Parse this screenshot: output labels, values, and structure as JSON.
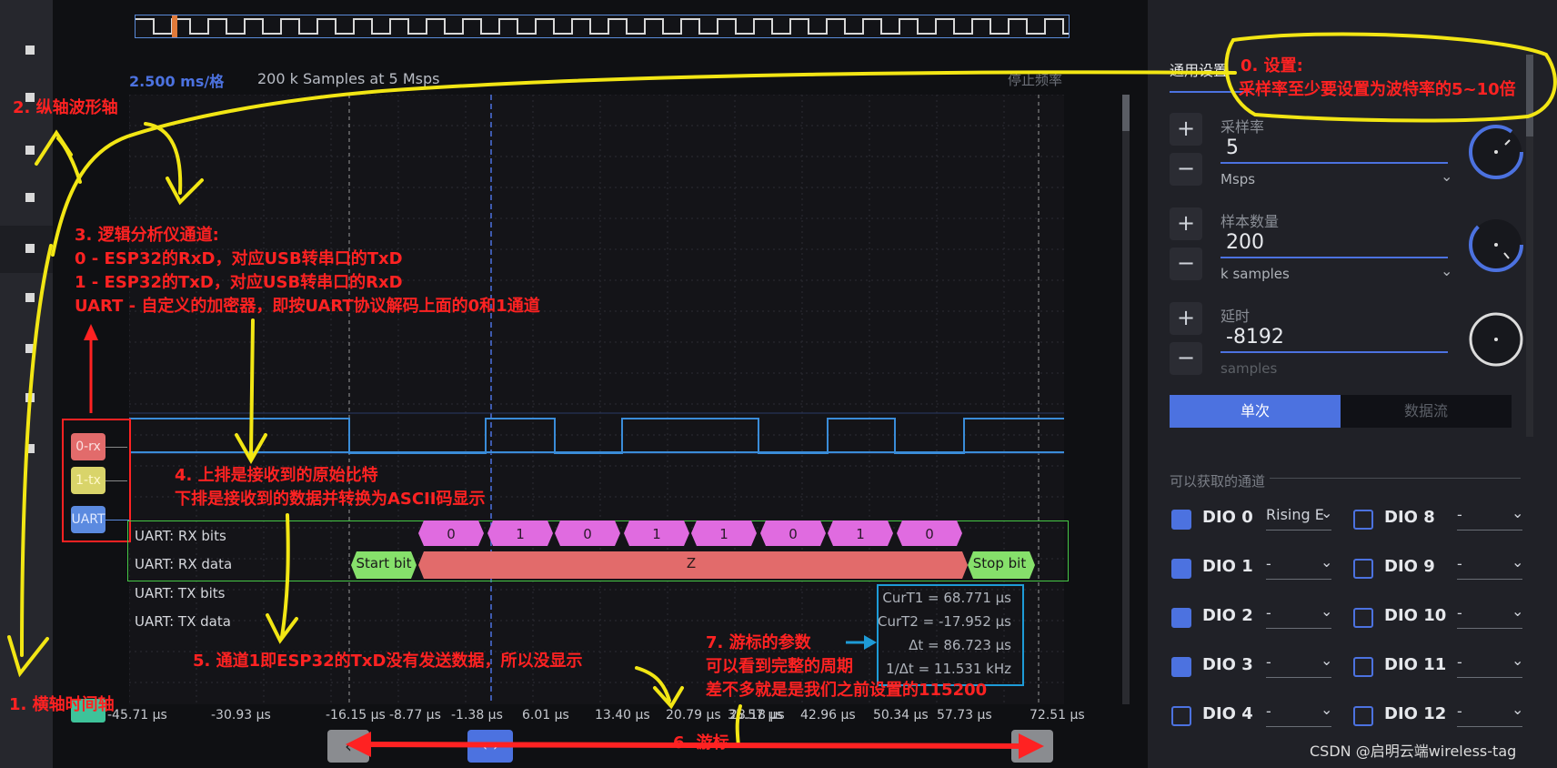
{
  "header": {
    "time_div": "2.500 ms/格",
    "samples_info": "200 k Samples at 5 Msps",
    "stop_label": "停止频率"
  },
  "channels": {
    "ch0": "0-rx",
    "ch1": "1-tx",
    "uart": "UART"
  },
  "decoder_rows": {
    "rx_bits": "UART: RX bits",
    "rx_data": "UART: RX data",
    "tx_bits": "UART: TX bits",
    "tx_data": "UART: TX data"
  },
  "rx_bits_values": [
    "0",
    "1",
    "0",
    "1",
    "1",
    "0",
    "1",
    "0"
  ],
  "rx_data": {
    "start": "Start bit",
    "char": "Z",
    "stop": "Stop bit"
  },
  "cursor_info": {
    "t1": "CurT1 = 68.771 μs",
    "t2": "CurT2 = -17.952 μs",
    "dt": "Δt = 86.723 μs",
    "inv_dt": "1/Δt = 11.531 kHz"
  },
  "x_ticks": [
    "-45.71 μs",
    "-30.93 μs",
    "-16.15 μs",
    "-8.77 μs",
    "-1.38 μs",
    "6.01 μs",
    "13.40 μs",
    "20.79 μs",
    "28.18 μs",
    "35.57 μs",
    "42.96 μs",
    "50.34 μs",
    "57.73 μs",
    "72.51 μs"
  ],
  "nav": {
    "left": "‹",
    "center": "‹ ›",
    "right": "›"
  },
  "settings": {
    "tab": "通用设置",
    "rate": {
      "label": "采样率",
      "value": "5",
      "unit": "Msps"
    },
    "count": {
      "label": "样本数量",
      "value": "200",
      "unit": "k samples"
    },
    "delay": {
      "label": "延时",
      "value": "-8192",
      "unit": "samples"
    },
    "single": "单次",
    "stream": "数据流",
    "channels_title": "可以获取的通道",
    "plus": "+",
    "minus": "−"
  },
  "dio": [
    {
      "name": "DIO 0",
      "trig": "Rising E",
      "checked": true
    },
    {
      "name": "DIO 1",
      "trig": "-",
      "checked": true
    },
    {
      "name": "DIO 2",
      "trig": "-",
      "checked": true
    },
    {
      "name": "DIO 3",
      "trig": "-",
      "checked": true
    },
    {
      "name": "DIO 4",
      "trig": "-",
      "checked": false
    },
    {
      "name": "DIO 8",
      "trig": "-",
      "checked": false
    },
    {
      "name": "DIO 9",
      "trig": "-",
      "checked": false
    },
    {
      "name": "DIO 10",
      "trig": "-",
      "checked": false
    },
    {
      "name": "DIO 11",
      "trig": "-",
      "checked": false
    },
    {
      "name": "DIO 12",
      "trig": "-",
      "checked": false
    }
  ],
  "annotations": {
    "a0_title": "0. 设置:",
    "a0_body": "采样率至少要设置为波特率的5~10倍",
    "a1": "1. 横轴时间轴",
    "a2": "2. 纵轴波形轴",
    "a3_l1": "3. 逻辑分析仪通道:",
    "a3_l2": "0 - ESP32的RxD，对应USB转串口的TxD",
    "a3_l3": "1 - ESP32的TxD，对应USB转串口的RxD",
    "a3_l4": "UART - 自定义的加密器，即按UART协议解码上面的0和1通道",
    "a4_l1": "4. 上排是接收到的原始比特",
    "a4_l2": "下排是接收到的数据并转换为ASCII码显示",
    "a5": "5. 通道1即ESP32的TxD没有发送数据，所以没显示",
    "a6": "6. 游标",
    "a7_l1": "7. 游标的参数",
    "a7_l2": "可以看到完整的周期",
    "a7_l3": "差不多就是是我们之前设置的115200"
  },
  "watermark": "CSDN @启明云端wireless-tag",
  "colors": {
    "accent": "#4c72e0",
    "annotation_red": "#ff2222",
    "annotation_yellow": "#f2e614",
    "bits_magenta": "#e06be0",
    "data_red": "#e26b6b",
    "start_stop_green": "#86e06b",
    "ch0_color": "#e26b6b",
    "ch1_color": "#e0dc6b",
    "uart_color": "#5b8ae0"
  }
}
